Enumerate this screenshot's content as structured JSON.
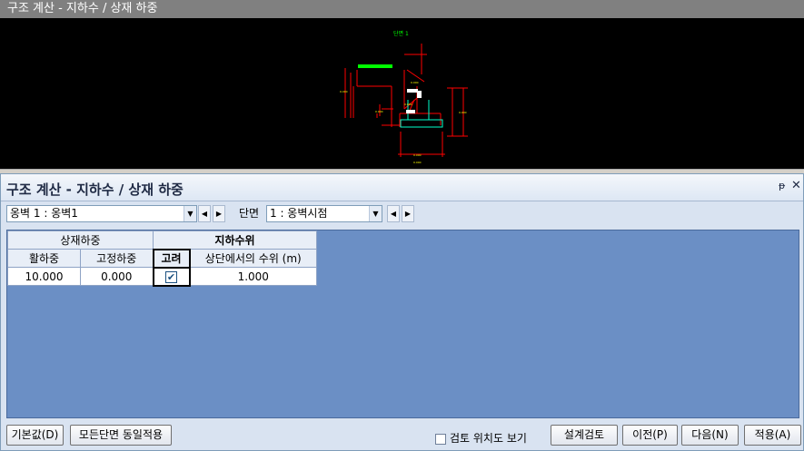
{
  "window": {
    "title": "구조 계산 - 지하수 / 상재 하중"
  },
  "drawing": {
    "section_label": "단면 1",
    "line_color": "#ff0000",
    "dim_color": "#ffff00",
    "green_color": "#00ff00"
  },
  "panel": {
    "title": "구조 계산 - 지하수 / 상재 하중",
    "pin_icon": "pin-icon",
    "close_icon": "close-icon",
    "wall_combo": {
      "value": "옹벽 1 : 옹벽1"
    },
    "section_label": "단면",
    "section_combo": {
      "value": "1 : 옹벽시점"
    }
  },
  "grid": {
    "group_surcharge": "상재하중",
    "group_groundwater": "지하수위",
    "col_live": "활하중",
    "col_fixed": "고정하중",
    "col_consider": "고려",
    "col_level": "상단에서의 수위 (m)",
    "row": {
      "live": "10.000",
      "fixed": "0.000",
      "consider": true,
      "level": "1.000"
    }
  },
  "bottom": {
    "default_btn": "기본값(D)",
    "apply_all_btn": "모든단면 동일적용",
    "check_label": "검토 위치도 보기",
    "design_btn": "설계검토",
    "prev_btn": "이전(P)",
    "next_btn": "다음(N)",
    "apply_btn": "적용(A)"
  }
}
